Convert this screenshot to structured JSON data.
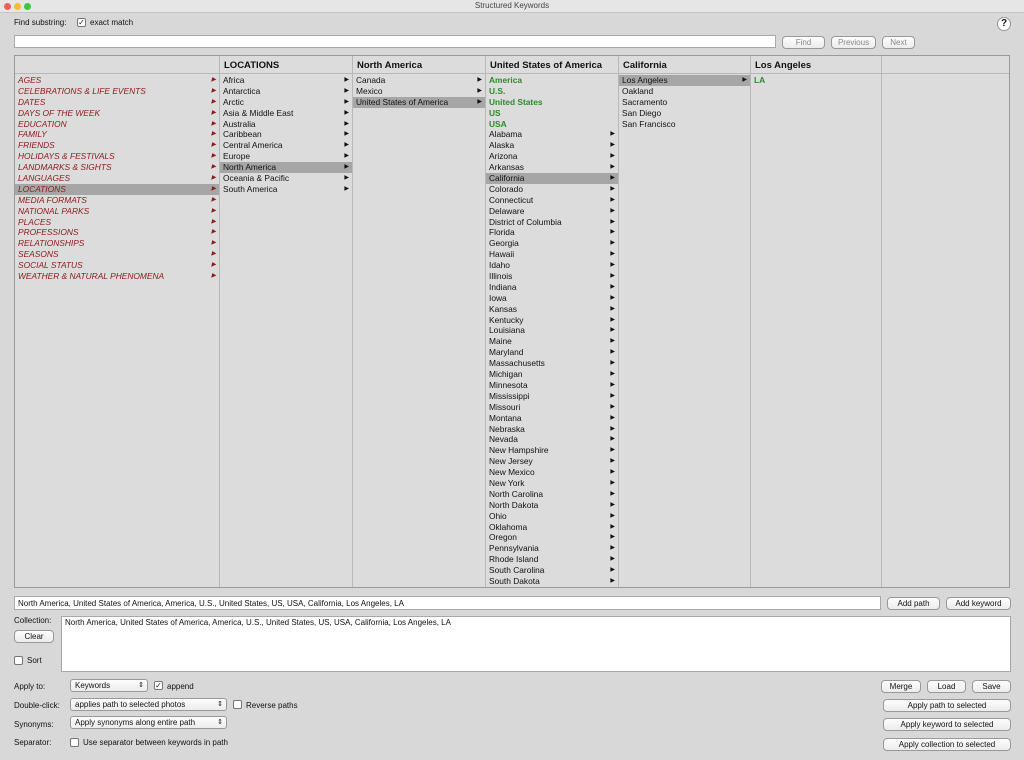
{
  "window": {
    "title": "Structured Keywords"
  },
  "find": {
    "label": "Find substring:",
    "exact_label": "exact match",
    "exact_checked": true,
    "input_value": "",
    "find_btn": "Find",
    "prev_btn": "Previous",
    "next_btn": "Next",
    "help": "?"
  },
  "columns": [
    {
      "header": "",
      "items": [
        {
          "label": "AGES",
          "arrow": true
        },
        {
          "label": "CELEBRATIONS & LIFE EVENTS",
          "arrow": true
        },
        {
          "label": "DATES",
          "arrow": true
        },
        {
          "label": "DAYS OF THE WEEK",
          "arrow": true
        },
        {
          "label": "EDUCATION",
          "arrow": true
        },
        {
          "label": "FAMILY",
          "arrow": true
        },
        {
          "label": "FRIENDS",
          "arrow": true
        },
        {
          "label": "HOLIDAYS & FESTIVALS",
          "arrow": true
        },
        {
          "label": "LANDMARKS & SIGHTS",
          "arrow": true
        },
        {
          "label": "LANGUAGES",
          "arrow": true
        },
        {
          "label": "LOCATIONS",
          "arrow": true,
          "selected": true
        },
        {
          "label": "MEDIA FORMATS",
          "arrow": true
        },
        {
          "label": "NATIONAL PARKS",
          "arrow": true
        },
        {
          "label": "PLACES",
          "arrow": true
        },
        {
          "label": "PROFESSIONS",
          "arrow": true
        },
        {
          "label": "RELATIONSHIPS",
          "arrow": true
        },
        {
          "label": "SEASONS",
          "arrow": true
        },
        {
          "label": "SOCIAL STATUS",
          "arrow": true
        },
        {
          "label": "WEATHER & NATURAL PHENOMENA",
          "arrow": true
        }
      ]
    },
    {
      "header": "LOCATIONS",
      "items": [
        {
          "label": "Africa",
          "arrow": true
        },
        {
          "label": "Antarctica",
          "arrow": true
        },
        {
          "label": "Arctic",
          "arrow": true
        },
        {
          "label": "Asia & Middle East",
          "arrow": true
        },
        {
          "label": "Australia",
          "arrow": true
        },
        {
          "label": "Caribbean",
          "arrow": true
        },
        {
          "label": "Central America",
          "arrow": true
        },
        {
          "label": "Europe",
          "arrow": true
        },
        {
          "label": "North America",
          "arrow": true,
          "selected": true
        },
        {
          "label": "Oceania & Pacific",
          "arrow": true
        },
        {
          "label": "South America",
          "arrow": true
        }
      ]
    },
    {
      "header": "North America",
      "items": [
        {
          "label": "Canada",
          "arrow": true
        },
        {
          "label": "Mexico",
          "arrow": true
        },
        {
          "label": "United States of America",
          "arrow": true,
          "selected": true
        }
      ]
    },
    {
      "header": "United States of America",
      "items": [
        {
          "label": "America",
          "green": true
        },
        {
          "label": "U.S.",
          "green": true
        },
        {
          "label": "United States",
          "green": true
        },
        {
          "label": "US",
          "green": true
        },
        {
          "label": "USA",
          "green": true
        },
        {
          "label": "Alabama",
          "arrow": true
        },
        {
          "label": "Alaska",
          "arrow": true
        },
        {
          "label": "Arizona",
          "arrow": true
        },
        {
          "label": "Arkansas",
          "arrow": true
        },
        {
          "label": "California",
          "arrow": true,
          "selected": true
        },
        {
          "label": "Colorado",
          "arrow": true
        },
        {
          "label": "Connecticut",
          "arrow": true
        },
        {
          "label": "Delaware",
          "arrow": true
        },
        {
          "label": "District of Columbia",
          "arrow": true
        },
        {
          "label": "Florida",
          "arrow": true
        },
        {
          "label": "Georgia",
          "arrow": true
        },
        {
          "label": "Hawaii",
          "arrow": true
        },
        {
          "label": "Idaho",
          "arrow": true
        },
        {
          "label": "Illinois",
          "arrow": true
        },
        {
          "label": "Indiana",
          "arrow": true
        },
        {
          "label": "Iowa",
          "arrow": true
        },
        {
          "label": "Kansas",
          "arrow": true
        },
        {
          "label": "Kentucky",
          "arrow": true
        },
        {
          "label": "Louisiana",
          "arrow": true
        },
        {
          "label": "Maine",
          "arrow": true
        },
        {
          "label": "Maryland",
          "arrow": true
        },
        {
          "label": "Massachusetts",
          "arrow": true
        },
        {
          "label": "Michigan",
          "arrow": true
        },
        {
          "label": "Minnesota",
          "arrow": true
        },
        {
          "label": "Mississippi",
          "arrow": true
        },
        {
          "label": "Missouri",
          "arrow": true
        },
        {
          "label": "Montana",
          "arrow": true
        },
        {
          "label": "Nebraska",
          "arrow": true
        },
        {
          "label": "Nevada",
          "arrow": true
        },
        {
          "label": "New Hampshire",
          "arrow": true
        },
        {
          "label": "New Jersey",
          "arrow": true
        },
        {
          "label": "New Mexico",
          "arrow": true
        },
        {
          "label": "New York",
          "arrow": true
        },
        {
          "label": "North Carolina",
          "arrow": true
        },
        {
          "label": "North Dakota",
          "arrow": true
        },
        {
          "label": "Ohio",
          "arrow": true
        },
        {
          "label": "Oklahoma",
          "arrow": true
        },
        {
          "label": "Oregon",
          "arrow": true
        },
        {
          "label": "Pennsylvania",
          "arrow": true
        },
        {
          "label": "Rhode Island",
          "arrow": true
        },
        {
          "label": "South Carolina",
          "arrow": true
        },
        {
          "label": "South Dakota",
          "arrow": true
        }
      ]
    },
    {
      "header": "California",
      "items": [
        {
          "label": "Los Angeles",
          "arrow": true,
          "selected": true
        },
        {
          "label": "Oakland"
        },
        {
          "label": "Sacramento"
        },
        {
          "label": "San Diego"
        },
        {
          "label": "San Francisco"
        }
      ]
    },
    {
      "header": "Los Angeles",
      "items": [
        {
          "label": "LA",
          "green": true
        }
      ]
    },
    {
      "header": "",
      "items": []
    }
  ],
  "path_bar": {
    "value": "North America, United States of America, America, U.S., United States, US, USA, California, Los Angeles, LA",
    "add_path_btn": "Add path",
    "add_keyword_btn": "Add keyword"
  },
  "collection": {
    "label": "Collection:",
    "clear_btn": "Clear",
    "sort_label": "Sort",
    "sort_checked": false,
    "text": "North America, United States of America, America, U.S., United States, US, USA, California, Los Angeles, LA"
  },
  "options": {
    "apply_to_label": "Apply to:",
    "apply_to_value": "Keywords",
    "append_label": "append",
    "append_checked": true,
    "double_click_label": "Double-click:",
    "double_click_value": "applies path to selected photos",
    "reverse_label": "Reverse paths",
    "reverse_checked": false,
    "synonyms_label": "Synonyms:",
    "synonyms_value": "Apply synonyms along entire path",
    "separator_label": "Separator:",
    "separator_option_label": "Use separator between keywords in path",
    "separator_checked": false
  },
  "actions": {
    "merge_btn": "Merge",
    "load_btn": "Load",
    "save_btn": "Save",
    "apply_path_btn": "Apply path to selected",
    "apply_keyword_btn": "Apply keyword to selected",
    "apply_collection_btn": "Apply collection to selected"
  }
}
